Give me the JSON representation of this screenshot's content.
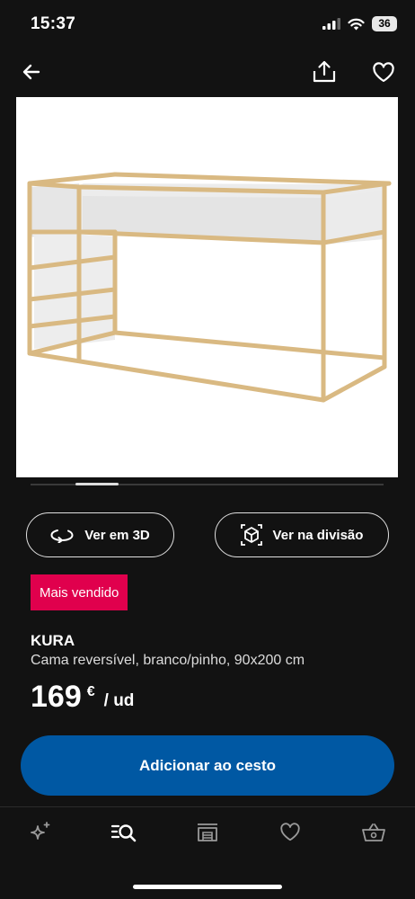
{
  "status_bar": {
    "time": "15:37",
    "battery": "36"
  },
  "header": {
    "back_icon": "arrow-left-icon",
    "share_icon": "share-icon",
    "favorite_icon": "heart-icon"
  },
  "product_image": {
    "alt": "KURA bed image",
    "carousel_position": 1
  },
  "actions": {
    "view_3d": "Ver em 3D",
    "view_room": "Ver na divisão"
  },
  "product": {
    "badge": "Mais vendido",
    "name": "KURA",
    "description": "Cama reversível, branco/pinho, 90x200 cm",
    "price": "169",
    "currency": "€",
    "unit": "/ ud"
  },
  "cta": {
    "label": "Adicionar ao cesto"
  },
  "tabbar": {
    "items": [
      {
        "icon": "sparkle-icon"
      },
      {
        "icon": "search-list-icon"
      },
      {
        "icon": "store-icon"
      },
      {
        "icon": "heart-icon"
      },
      {
        "icon": "basket-icon"
      }
    ]
  },
  "colors": {
    "background": "#121212",
    "cta": "#0058a3",
    "badge": "#e0004d"
  }
}
